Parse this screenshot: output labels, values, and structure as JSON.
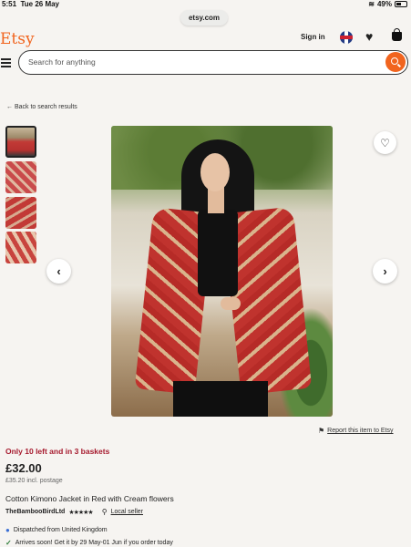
{
  "status_bar": {
    "time": "5:51",
    "date": "Tue 26 May",
    "battery": "49%"
  },
  "browser": {
    "url": "etsy.com"
  },
  "header": {
    "logo": "Etsy",
    "sign_in": "Sign in"
  },
  "search": {
    "placeholder": "Search for anything",
    "value": ""
  },
  "nav": {
    "back_link": "← Back to search results"
  },
  "gallery": {
    "thumbnail_count": 4,
    "selected_index": 1
  },
  "actions": {
    "report": "Report this item to Etsy"
  },
  "product": {
    "stock_notice": "Only 10 left and in 3 baskets",
    "price": "£32.00",
    "postage": "£35.20 incl. postage",
    "title": "Cotton Kimono Jacket in Red with Cream flowers",
    "shop_name": "TheBambooBirdLtd",
    "rating_stars": "★★★★★",
    "local_seller": "Local seller",
    "dispatch": "Dispatched from United Kingdom",
    "arrival": "Arrives soon! Get it by 29 May-01 Jun if you order today"
  },
  "colors": {
    "brand": "#f1641e",
    "stock_notice": "#a61a2e"
  }
}
